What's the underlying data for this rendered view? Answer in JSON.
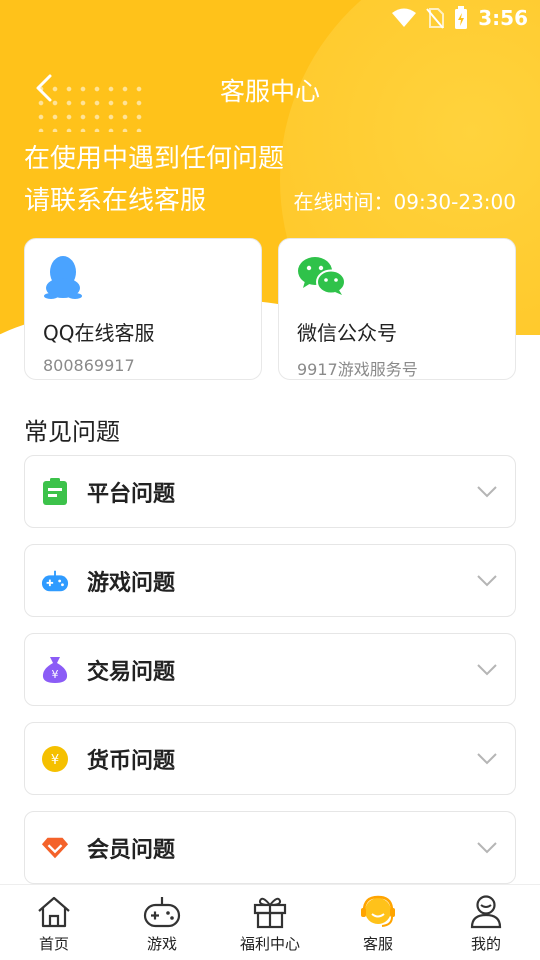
{
  "status_bar": {
    "time": "3:56"
  },
  "header": {
    "title": "客服中心"
  },
  "hero": {
    "line1": "在使用中遇到任何问题",
    "line2": "请联系在线客服",
    "online_time": "在线时间：09:30-23:00"
  },
  "contacts": [
    {
      "label": "QQ在线客服",
      "sub": "800869917",
      "icon": "qq-icon"
    },
    {
      "label": "微信公众号",
      "sub": "9917游戏服务号",
      "icon": "wechat-icon"
    }
  ],
  "faq": {
    "section_title": "常见问题",
    "items": [
      {
        "label": "平台问题",
        "icon": "clipboard-icon"
      },
      {
        "label": "游戏问题",
        "icon": "gamepad-icon"
      },
      {
        "label": "交易问题",
        "icon": "money-bag-icon"
      },
      {
        "label": "货币问题",
        "icon": "coin-icon"
      },
      {
        "label": "会员问题",
        "icon": "diamond-icon"
      }
    ]
  },
  "tabs": [
    {
      "label": "首页",
      "icon": "home-icon"
    },
    {
      "label": "游戏",
      "icon": "gamepad-icon"
    },
    {
      "label": "福利中心",
      "icon": "gift-icon"
    },
    {
      "label": "客服",
      "icon": "headset-icon",
      "active": true
    },
    {
      "label": "我的",
      "icon": "user-icon"
    }
  ],
  "colors": {
    "brand": "#ffc21a",
    "green": "#3cc24a",
    "blue": "#2f9bff",
    "purple": "#8b5cf6",
    "gold": "#f5c000",
    "orange": "#f4622a",
    "wechat": "#2fc24a",
    "qq": "#4aa3ff"
  }
}
